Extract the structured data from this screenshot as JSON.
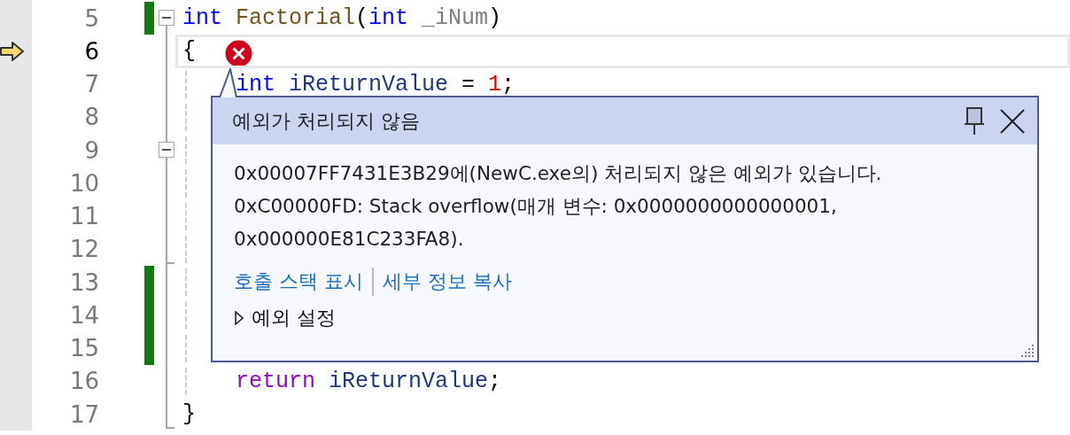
{
  "editor": {
    "lines": [
      {
        "number": "5",
        "current": false,
        "changed": true,
        "fold_box": true,
        "fold_end": false,
        "kind": "declaration",
        "code": [
          {
            "kind": "keyword",
            "text": "int"
          },
          {
            "kind": "function",
            "text": " Factorial"
          },
          {
            "kind": "plain",
            "text": "("
          },
          {
            "kind": "keyword",
            "text": "int"
          },
          {
            "kind": "param",
            "text": " _iNum"
          },
          {
            "kind": "plain",
            "text": ")"
          }
        ]
      },
      {
        "number": "6",
        "current": true,
        "changed": false,
        "fold_box": false,
        "fold_end": false,
        "kind": "brace",
        "code": [
          {
            "kind": "plain",
            "text": "{"
          }
        ]
      },
      {
        "number": "7",
        "current": false,
        "changed": false,
        "fold_box": false,
        "fold_end": false,
        "kind": "statement",
        "code": [
          {
            "kind": "keyword",
            "text": "int"
          },
          {
            "kind": "local",
            "text": " iReturnValue"
          },
          {
            "kind": "plain",
            "text": " = "
          },
          {
            "kind": "number",
            "text": "1"
          },
          {
            "kind": "plain",
            "text": ";"
          }
        ]
      },
      {
        "number": "8",
        "current": false,
        "changed": false,
        "fold_box": false,
        "fold_end": false
      },
      {
        "number": "9",
        "current": false,
        "changed": false,
        "fold_box": true,
        "fold_end": false
      },
      {
        "number": "10",
        "current": false,
        "changed": false,
        "fold_box": false,
        "fold_end": false
      },
      {
        "number": "11",
        "current": false,
        "changed": false,
        "fold_box": false,
        "fold_end": false
      },
      {
        "number": "12",
        "current": false,
        "changed": false,
        "fold_box": false,
        "fold_end": true
      },
      {
        "number": "13",
        "current": false,
        "changed": true,
        "fold_box": false,
        "fold_end": false
      },
      {
        "number": "14",
        "current": false,
        "changed": true,
        "fold_box": false,
        "fold_end": false
      },
      {
        "number": "15",
        "current": false,
        "changed": true,
        "fold_box": false,
        "fold_end": false
      },
      {
        "number": "16",
        "current": false,
        "changed": false,
        "fold_box": false,
        "fold_end": false,
        "kind": "statement",
        "code": [
          {
            "kind": "control",
            "text": "return"
          },
          {
            "kind": "local",
            "text": " iReturnValue"
          },
          {
            "kind": "plain",
            "text": ";"
          }
        ]
      },
      {
        "number": "17",
        "current": false,
        "changed": false,
        "fold_box": false,
        "fold_end": true,
        "kind": "brace",
        "code": [
          {
            "kind": "plain",
            "text": "}"
          }
        ]
      }
    ]
  },
  "exception_popup": {
    "title": "예외가 처리되지 않음",
    "message": "0x00007FF7431E3B29에(NewC.exe의) 처리되지 않은 예외가 있습니다. 0xC00000FD: Stack overflow(매개 변수: 0x0000000000000001, 0x000000E81C233FA8).",
    "links": [
      "호출 스택 표시",
      "세부 정보 복사"
    ],
    "settings": {
      "label": "예외 설정",
      "expanded": false
    }
  }
}
